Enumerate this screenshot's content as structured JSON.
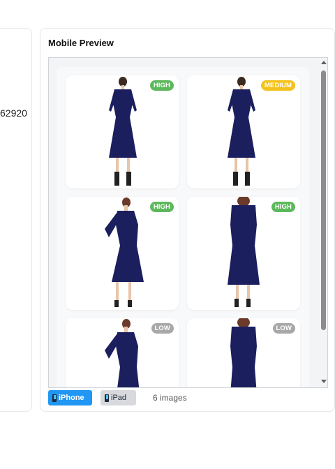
{
  "left_card": {
    "partial_text": "62920"
  },
  "panel": {
    "title": "Mobile Preview"
  },
  "images": [
    {
      "badge": "HIGH",
      "color": "#5cb85c",
      "pose": "front-full"
    },
    {
      "badge": "MEDIUM",
      "color": "#f4c21c",
      "pose": "front-full"
    },
    {
      "badge": "HIGH",
      "color": "#5cb85c",
      "pose": "side-full"
    },
    {
      "badge": "HIGH",
      "color": "#5cb85c",
      "pose": "back-full"
    },
    {
      "badge": "LOW",
      "color": "#a8a8a8",
      "pose": "side-crop"
    },
    {
      "badge": "LOW",
      "color": "#a8a8a8",
      "pose": "back-crop"
    }
  ],
  "device_buttons": {
    "iphone": "iPhone",
    "ipad": "iPad"
  },
  "image_count": "6 images",
  "colors": {
    "dress": "#1b1f5e",
    "accent": "#2196f3"
  }
}
